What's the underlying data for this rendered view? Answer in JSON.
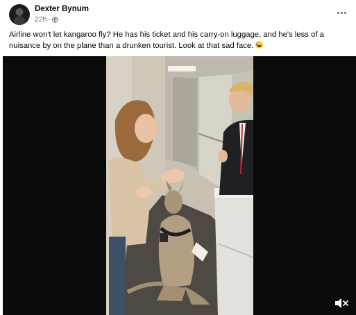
{
  "post": {
    "author": "Dexter Bynum",
    "time": "22h",
    "separator": "·",
    "privacy_icon": "globe-icon",
    "menu_icon": "more-horizontal-icon",
    "caption": "Airline won't let kangaroo fly? He has his ticket and his carry-on luggage, and he's less of a nuisance by on the plane than a drunken tourist. Look at that sad face."
  },
  "video": {
    "control_icon": "volume-muted-icon"
  },
  "colors": {
    "text_primary": "#050505",
    "text_secondary": "#65676b",
    "video_letterbox": "#0b0b0b"
  }
}
